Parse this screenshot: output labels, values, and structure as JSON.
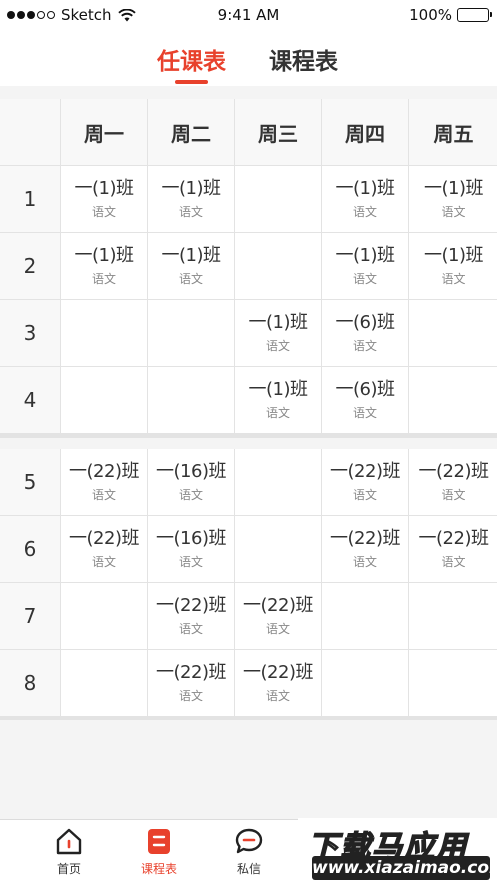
{
  "status_bar": {
    "carrier": "Sketch",
    "time": "9:41 AM",
    "battery": "100%"
  },
  "header": {
    "tabs": [
      {
        "label": "任课表",
        "active": true
      },
      {
        "label": "课程表",
        "active": false
      }
    ]
  },
  "timetable": {
    "days": [
      "周一",
      "周二",
      "周三",
      "周四",
      "周五"
    ],
    "periods": [
      {
        "label": "1",
        "cells": [
          {
            "class": "一(1)班",
            "subject": "语文"
          },
          {
            "class": "一(1)班",
            "subject": "语文"
          },
          null,
          {
            "class": "一(1)班",
            "subject": "语文"
          },
          {
            "class": "一(1)班",
            "subject": "语文"
          }
        ]
      },
      {
        "label": "2",
        "cells": [
          {
            "class": "一(1)班",
            "subject": "语文"
          },
          {
            "class": "一(1)班",
            "subject": "语文"
          },
          null,
          {
            "class": "一(1)班",
            "subject": "语文"
          },
          {
            "class": "一(1)班",
            "subject": "语文"
          }
        ]
      },
      {
        "label": "3",
        "cells": [
          null,
          null,
          {
            "class": "一(1)班",
            "subject": "语文"
          },
          {
            "class": "一(6)班",
            "subject": "语文"
          },
          null
        ]
      },
      {
        "label": "4",
        "cells": [
          null,
          null,
          {
            "class": "一(1)班",
            "subject": "语文"
          },
          {
            "class": "一(6)班",
            "subject": "语文"
          },
          null
        ]
      },
      {
        "label": "5",
        "cells": [
          {
            "class": "一(22)班",
            "subject": "语文"
          },
          {
            "class": "一(16)班",
            "subject": "语文"
          },
          null,
          {
            "class": "一(22)班",
            "subject": "语文"
          },
          {
            "class": "一(22)班",
            "subject": "语文"
          }
        ]
      },
      {
        "label": "6",
        "cells": [
          {
            "class": "一(22)班",
            "subject": "语文"
          },
          {
            "class": "一(16)班",
            "subject": "语文"
          },
          null,
          {
            "class": "一(22)班",
            "subject": "语文"
          },
          {
            "class": "一(22)班",
            "subject": "语文"
          }
        ]
      },
      {
        "label": "7",
        "cells": [
          null,
          {
            "class": "一(22)班",
            "subject": "语文"
          },
          {
            "class": "一(22)班",
            "subject": "语文"
          },
          null,
          null
        ]
      },
      {
        "label": "8",
        "cells": [
          null,
          {
            "class": "一(22)班",
            "subject": "语文"
          },
          {
            "class": "一(22)班",
            "subject": "语文"
          },
          null,
          null
        ]
      }
    ]
  },
  "bottom_nav": {
    "items": [
      {
        "label": "首页",
        "icon": "home-icon",
        "active": false
      },
      {
        "label": "课程表",
        "icon": "schedule-icon",
        "active": true
      },
      {
        "label": "私信",
        "icon": "message-icon",
        "active": false
      }
    ]
  },
  "watermark": {
    "line1": "下载马应用",
    "line2": "www.xiazaimao.com"
  },
  "colors": {
    "accent": "#e8412c",
    "text": "#333333",
    "subtle_text": "#888888",
    "grid_line": "#e3e3e3",
    "background": "#f4f4f4"
  }
}
